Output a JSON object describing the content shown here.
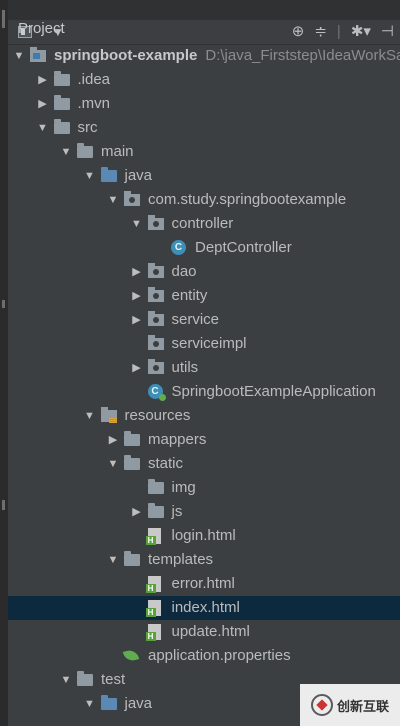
{
  "toolbar": {
    "view_label": "Project",
    "view_chevron": "▼",
    "icons": [
      "target-icon",
      "collapse-icon",
      "gear-icon",
      "hide-icon"
    ]
  },
  "tree": [
    {
      "label": "springboot-example",
      "path": "D:\\java_Firststep\\IdeaWorkSa",
      "icon": "module",
      "arrow": "down",
      "indent": 0
    },
    {
      "label": ".idea",
      "icon": "folder",
      "arrow": "right",
      "indent": 1
    },
    {
      "label": ".mvn",
      "icon": "folder",
      "arrow": "right",
      "indent": 1
    },
    {
      "label": "src",
      "icon": "folder",
      "arrow": "down",
      "indent": 1
    },
    {
      "label": "main",
      "icon": "folder",
      "arrow": "down",
      "indent": 2
    },
    {
      "label": "java",
      "icon": "src",
      "arrow": "down",
      "indent": 3
    },
    {
      "label": "com.study.springbootexample",
      "icon": "package",
      "arrow": "down",
      "indent": 4
    },
    {
      "label": "controller",
      "icon": "package",
      "arrow": "down",
      "indent": 5
    },
    {
      "label": "DeptController",
      "icon": "class",
      "arrow": "none",
      "indent": 6
    },
    {
      "label": "dao",
      "icon": "package",
      "arrow": "right",
      "indent": 5
    },
    {
      "label": "entity",
      "icon": "package",
      "arrow": "right",
      "indent": 5
    },
    {
      "label": "service",
      "icon": "package",
      "arrow": "right",
      "indent": 5
    },
    {
      "label": "serviceimpl",
      "icon": "package",
      "arrow": "none",
      "indent": 5
    },
    {
      "label": "utils",
      "icon": "package",
      "arrow": "right",
      "indent": 5
    },
    {
      "label": "SpringbootExampleApplication",
      "icon": "app",
      "arrow": "none",
      "indent": 5
    },
    {
      "label": "resources",
      "icon": "resources",
      "arrow": "down",
      "indent": 3
    },
    {
      "label": "mappers",
      "icon": "folder",
      "arrow": "right",
      "indent": 4
    },
    {
      "label": "static",
      "icon": "folder",
      "arrow": "down",
      "indent": 4
    },
    {
      "label": "img",
      "icon": "folder",
      "arrow": "none",
      "indent": 5
    },
    {
      "label": "js",
      "icon": "folder",
      "arrow": "right",
      "indent": 5
    },
    {
      "label": "login.html",
      "icon": "html",
      "arrow": "none",
      "indent": 5
    },
    {
      "label": "templates",
      "icon": "folder",
      "arrow": "down",
      "indent": 4
    },
    {
      "label": "error.html",
      "icon": "html",
      "arrow": "none",
      "indent": 5
    },
    {
      "label": "index.html",
      "icon": "html",
      "arrow": "none",
      "indent": 5,
      "selected": true
    },
    {
      "label": "update.html",
      "icon": "html",
      "arrow": "none",
      "indent": 5
    },
    {
      "label": "application.properties",
      "icon": "properties",
      "arrow": "none",
      "indent": 4
    },
    {
      "label": "test",
      "icon": "folder",
      "arrow": "down",
      "indent": 2
    },
    {
      "label": "java",
      "icon": "src-test",
      "arrow": "down",
      "indent": 3
    }
  ],
  "watermark": {
    "text": "创新互联"
  },
  "colors": {
    "background": "#3c3f41",
    "selection": "#0d293e",
    "text": "#bbbbbb",
    "source_folder": "#5a8ab3",
    "html_badge": "#57a23c"
  }
}
